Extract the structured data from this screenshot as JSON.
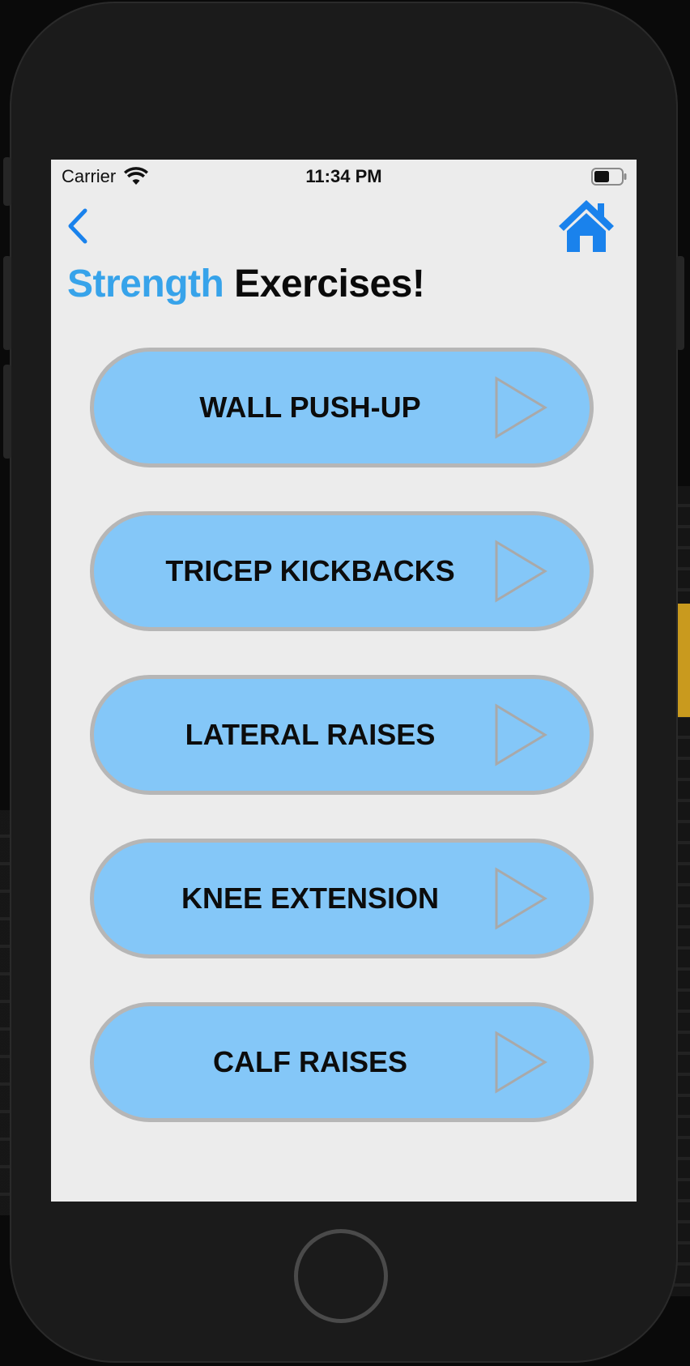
{
  "status_bar": {
    "carrier": "Carrier",
    "time": "11:34 PM"
  },
  "nav": {
    "back_icon": "chevron-left-icon",
    "home_icon": "house-icon",
    "accent_color": "#1f8ae8"
  },
  "header": {
    "title_accent": "Strength",
    "title_rest": "Exercises!"
  },
  "exercises": [
    {
      "label": "WALL PUSH-UP"
    },
    {
      "label": "TRICEP KICKBACKS"
    },
    {
      "label": "LATERAL RAISES"
    },
    {
      "label": "KNEE EXTENSION"
    },
    {
      "label": "CALF RAISES"
    }
  ],
  "colors": {
    "button_fill": "#84c7f8",
    "button_border": "#b6b6b6",
    "title_accent": "#37a3ea",
    "screen_bg": "#ececec"
  }
}
